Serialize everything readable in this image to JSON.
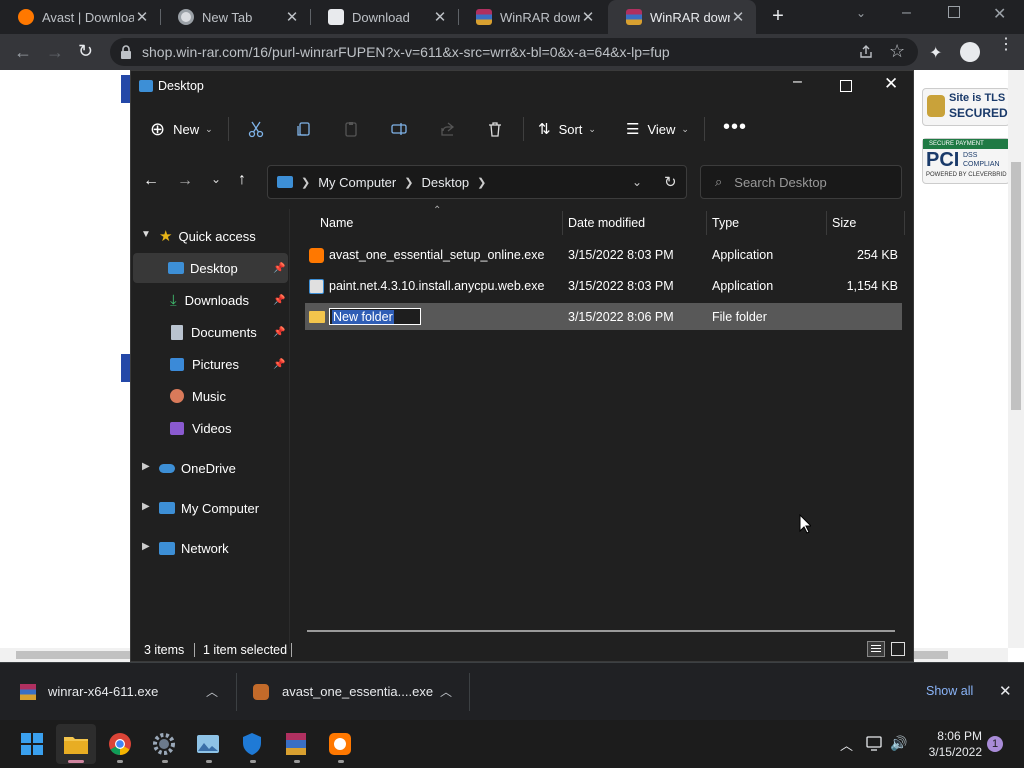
{
  "browser": {
    "tabs": [
      {
        "title": "Avast | Download",
        "icon": "avast-icon"
      },
      {
        "title": "New Tab",
        "icon": "chrome-icon"
      },
      {
        "title": "Download",
        "icon": "download-page-icon"
      },
      {
        "title": "WinRAR downlo",
        "icon": "winrar-icon"
      },
      {
        "title": "WinRAR downlo",
        "icon": "winrar-icon"
      }
    ],
    "active_tab": 4,
    "url": "shop.win-rar.com/16/purl-winrarFUPEN?x-v=611&x-src=wrr&x-bl=0&x-a=64&x-lp=fup"
  },
  "webpage": {
    "badge1_line1": "Site is TLS",
    "badge1_line2": "SECURED",
    "badge2_top": "SECURE PAYMENT",
    "badge2_pci": "PCI",
    "badge2_dss": "DSS",
    "badge2_compliant": "COMPLIAN",
    "badge2_powered": "POWERED BY CLEVERBRID"
  },
  "explorer": {
    "title": "Desktop",
    "toolbar": {
      "new": "New",
      "sort": "Sort",
      "view": "View"
    },
    "breadcrumb": [
      "My Computer",
      "Desktop"
    ],
    "search_placeholder": "Search Desktop",
    "columns": {
      "name": "Name",
      "date": "Date modified",
      "type": "Type",
      "size": "Size"
    },
    "sidebar": {
      "quick_access": "Quick access",
      "items": [
        "Desktop",
        "Downloads",
        "Documents",
        "Pictures",
        "Music",
        "Videos"
      ],
      "onedrive": "OneDrive",
      "my_computer": "My Computer",
      "network": "Network"
    },
    "files": [
      {
        "name": "avast_one_essential_setup_online.exe",
        "date": "3/15/2022 8:03 PM",
        "type": "Application",
        "size": "254 KB"
      },
      {
        "name": "paint.net.4.3.10.install.anycpu.web.exe",
        "date": "3/15/2022 8:03 PM",
        "type": "Application",
        "size": "1,154 KB"
      },
      {
        "name": "New folder",
        "date": "3/15/2022 8:06 PM",
        "type": "File folder",
        "size": ""
      }
    ],
    "status": {
      "items": "3 items",
      "selected": "1 item selected"
    }
  },
  "downloads": {
    "items": [
      "winrar-x64-611.exe",
      "avast_one_essentia....exe"
    ],
    "show_all": "Show all"
  },
  "taskbar": {
    "time": "8:06 PM",
    "date": "3/15/2022",
    "notification_count": "1"
  }
}
